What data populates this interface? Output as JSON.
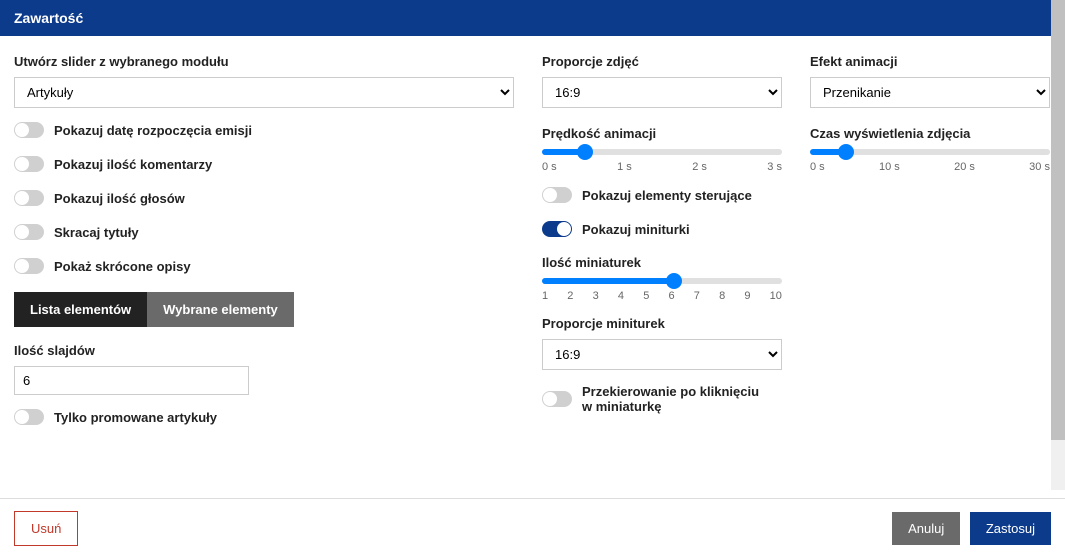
{
  "header": {
    "title": "Zawartość"
  },
  "left": {
    "module_label": "Utwórz slider z wybranego modułu",
    "module_value": "Artykuły",
    "toggles": [
      {
        "key": "show_start_date",
        "label": "Pokazuj datę rozpoczęcia emisji",
        "on": false
      },
      {
        "key": "show_comment_count",
        "label": "Pokazuj ilość komentarzy",
        "on": false
      },
      {
        "key": "show_vote_count",
        "label": "Pokazuj ilość głosów",
        "on": false
      },
      {
        "key": "shorten_titles",
        "label": "Skracaj tytuły",
        "on": false
      },
      {
        "key": "show_short_desc",
        "label": "Pokaż skrócone opisy",
        "on": false
      }
    ],
    "tabs": {
      "list": "Lista elementów",
      "selected": "Wybrane elementy"
    },
    "slides_count_label": "Ilość slajdów",
    "slides_count_value": "6",
    "promoted_only": {
      "label": "Tylko promowane artykuły",
      "on": false
    }
  },
  "mid": {
    "aspect_label": "Proporcje zdjęć",
    "aspect_value": "16:9",
    "anim_speed_label": "Prędkość animacji",
    "anim_speed_ticks": [
      "0 s",
      "1 s",
      "2 s",
      "3 s"
    ],
    "anim_speed_pct": 18,
    "show_controls": {
      "label": "Pokazuj elementy sterujące",
      "on": false
    },
    "show_thumbs": {
      "label": "Pokazuj miniturki",
      "on": true
    },
    "thumbs_count_label": "Ilość miniaturek",
    "thumbs_count_ticks": [
      "1",
      "2",
      "3",
      "4",
      "5",
      "6",
      "7",
      "8",
      "9",
      "10"
    ],
    "thumbs_count_pct": 55,
    "thumbs_aspect_label": "Proporcje miniturek",
    "thumbs_aspect_value": "16:9",
    "thumb_redirect": {
      "label": "Przekierowanie po kliknięciu w miniaturkę",
      "on": false
    }
  },
  "right": {
    "anim_effect_label": "Efekt animacji",
    "anim_effect_value": "Przenikanie",
    "display_time_label": "Czas wyświetlenia zdjęcia",
    "display_time_ticks": [
      "0 s",
      "10 s",
      "20 s",
      "30 s"
    ],
    "display_time_pct": 15
  },
  "footer": {
    "delete": "Usuń",
    "cancel": "Anuluj",
    "apply": "Zastosuj"
  }
}
